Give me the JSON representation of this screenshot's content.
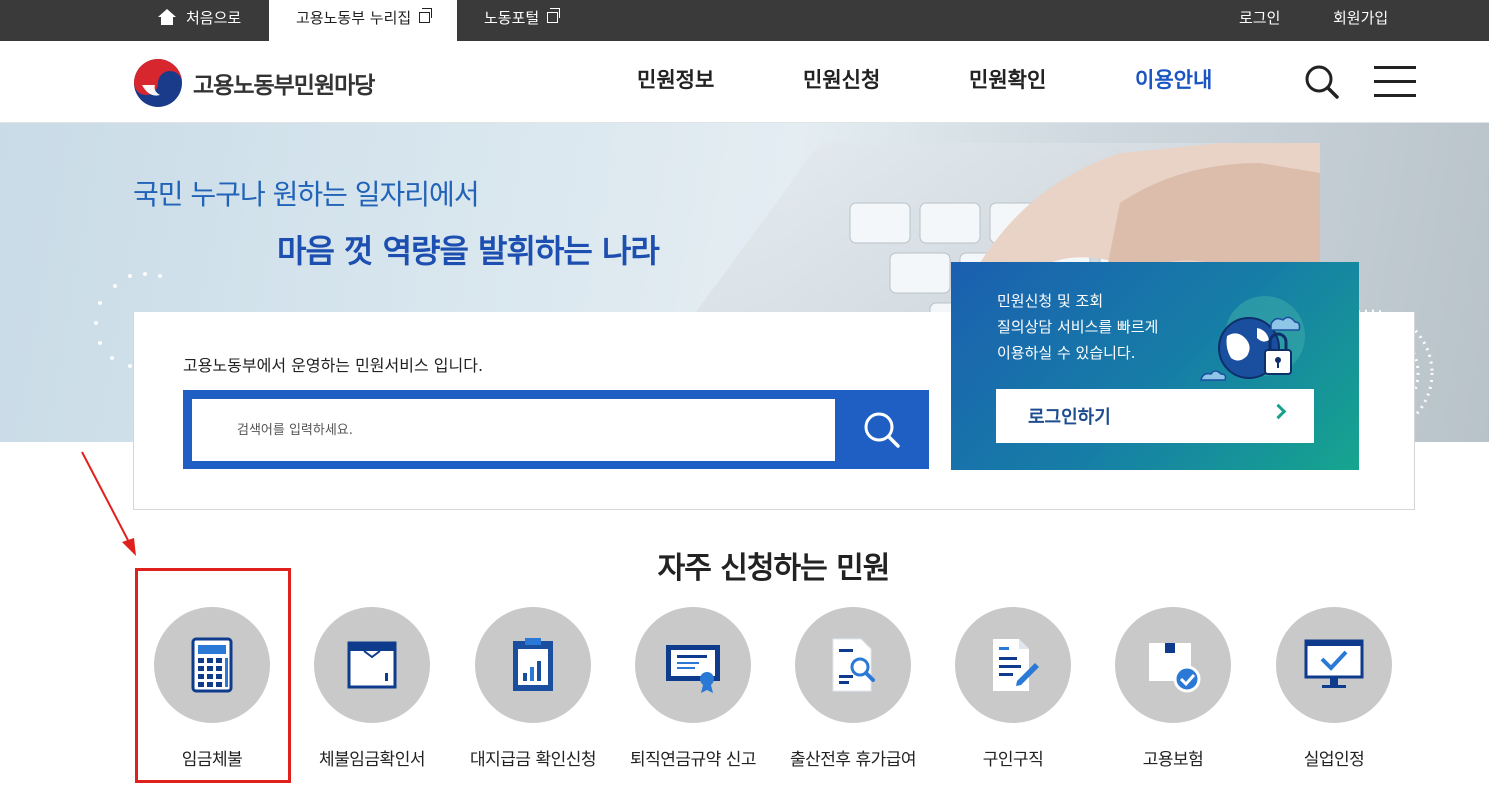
{
  "topbar": {
    "home": "처음으로",
    "tabs": [
      "고용노동부 누리집",
      "노동포털"
    ],
    "login": "로그인",
    "signup": "회원가입"
  },
  "header": {
    "logo_text": "고용노동부민원마당",
    "nav": [
      "민원정보",
      "민원신청",
      "민원확인",
      "이용안내"
    ],
    "active_nav": "이용안내"
  },
  "hero": {
    "line1": "국민 누구나 원하는 일자리에서",
    "line2": "마음 껏 역량을 발휘하는 나라"
  },
  "search": {
    "caption": "고용노동부에서 운영하는 민원서비스 입니다.",
    "placeholder": "검색어를 입력하세요."
  },
  "login_card": {
    "lines": [
      "민원신청 및 조회",
      "질의상담 서비스를 빠르게",
      "이용하실 수 있습니다."
    ],
    "button": "로그인하기"
  },
  "frequent": {
    "title": "자주 신청하는 민원",
    "items": [
      {
        "label": "임금체불",
        "icon": "calculator-icon"
      },
      {
        "label": "체불임금확인서",
        "icon": "document-box-icon"
      },
      {
        "label": "대지급금 확인신청",
        "icon": "chart-report-icon"
      },
      {
        "label": "퇴직연금규약 신고",
        "icon": "certificate-icon"
      },
      {
        "label": "출산전후 휴가급여",
        "icon": "document-search-icon"
      },
      {
        "label": "구인구직",
        "icon": "document-pen-icon"
      },
      {
        "label": "고용보험",
        "icon": "package-check-icon"
      },
      {
        "label": "실업인정",
        "icon": "monitor-check-icon"
      }
    ]
  },
  "colors": {
    "topbar": "#3a3a3a",
    "primary": "#1f5fc4",
    "annotation": "#e0201c"
  }
}
